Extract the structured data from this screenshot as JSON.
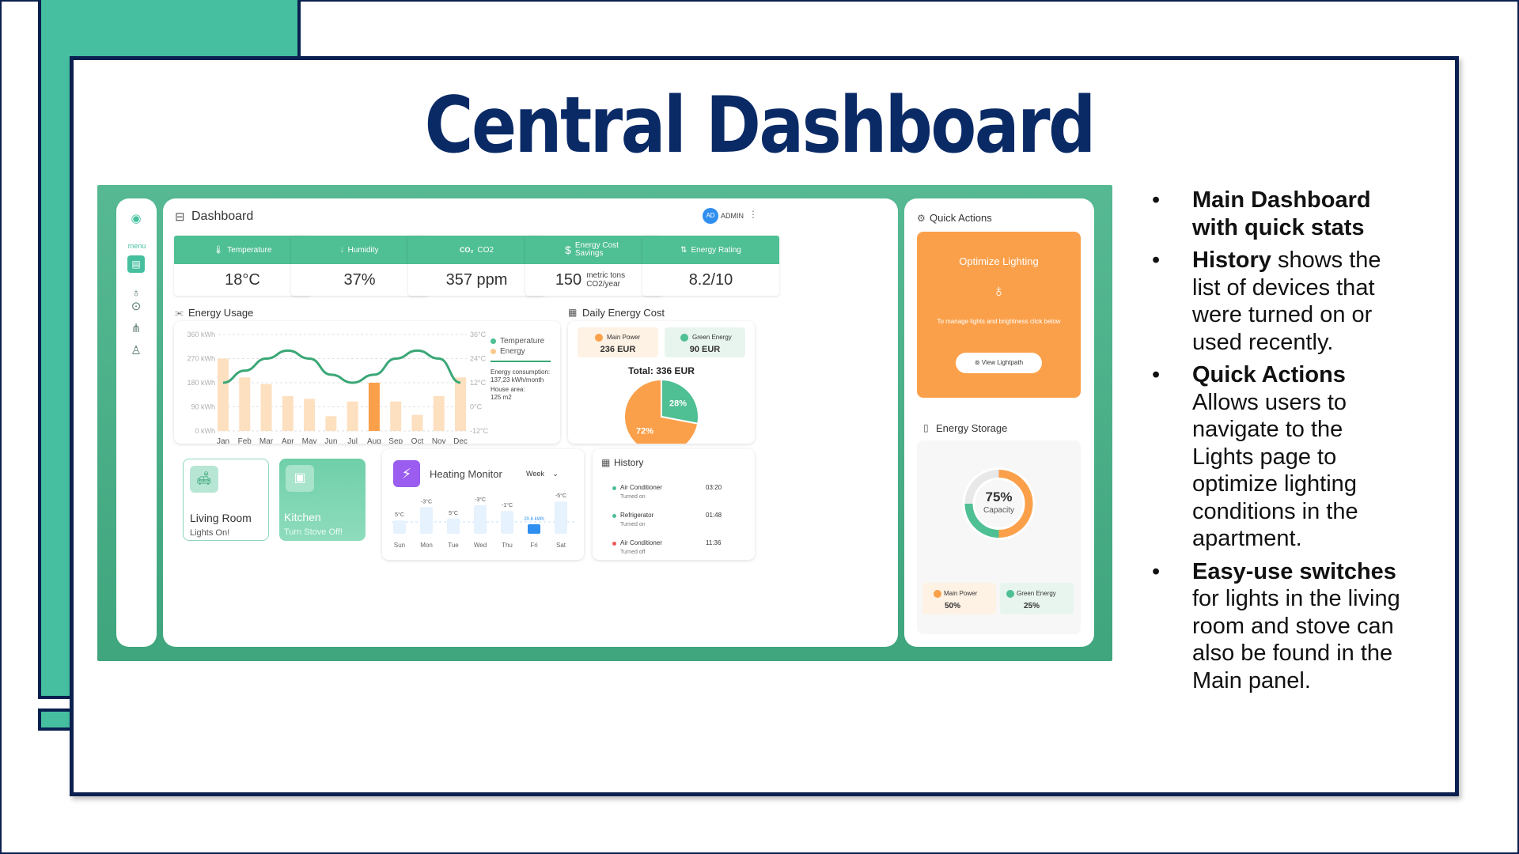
{
  "slide": {
    "title": "Central Dashboard",
    "bullets": [
      {
        "bold": "Main Dashboard with quick stats",
        "text": ""
      },
      {
        "bold": "History",
        "text": " shows the list of devices that were turned on or used recently."
      },
      {
        "bold": "Quick Actions",
        "text": " Allows users to navigate to the Lights page to optimize lighting conditions in the apartment."
      },
      {
        "bold": "Easy-use switches",
        "text": " for lights in the living room and stove can also be found in the Main panel."
      }
    ]
  },
  "colors": {
    "teal": "#45bf9f",
    "navy": "#0a2050",
    "orange": "#fba04a",
    "green": "#4fbf94",
    "purple": "#9b5cf0",
    "blue": "#2f8ff0"
  },
  "sidebar": {
    "menu_label": "menu",
    "icons": [
      "logo-icon",
      "dashboard-icon",
      "lightbulb-icon",
      "power-icon",
      "tower-icon",
      "user-icon"
    ]
  },
  "header": {
    "title": "Dashboard",
    "avatar_initials": "AD",
    "user_label": "ADMIN"
  },
  "stats": [
    {
      "label": "Temperature",
      "value": "18°C",
      "icon": "thermometer-icon"
    },
    {
      "label": "Humidity",
      "value": "37%",
      "icon": "drop-icon"
    },
    {
      "label": "CO2",
      "value": "357 ppm",
      "icon": "co2-icon"
    },
    {
      "label": "Energy Cost Savings",
      "value": "150",
      "unit": "metric tons CO2/year",
      "icon": "dollar-icon"
    },
    {
      "label": "Energy Rating",
      "value": "8.2/10",
      "icon": "rating-icon"
    }
  ],
  "energy_usage": {
    "title": "Energy Usage",
    "left_ticks": [
      "360 kWh",
      "270 kWh",
      "180 kWh",
      "90 kWh",
      "0 kWh"
    ],
    "right_ticks": [
      "36°C",
      "24°C",
      "12°C",
      "0°C",
      "-12°C"
    ],
    "legend": [
      "Temperature",
      "Energy"
    ],
    "info_consumption_label": "Energy consumption:",
    "info_consumption_value": "137,23 kWh/month",
    "info_area_label": "House area:",
    "info_area_value": "125 m2"
  },
  "chart_data": {
    "type": "bar",
    "categories": [
      "Jan",
      "Feb",
      "Mar",
      "Apr",
      "May",
      "Jun",
      "Jul",
      "Aug",
      "Sep",
      "Oct",
      "Nov",
      "Dec"
    ],
    "series": [
      {
        "name": "Energy",
        "values": [
          270,
          200,
          175,
          130,
          120,
          55,
          110,
          180,
          110,
          60,
          130,
          200
        ]
      },
      {
        "name": "Temperature",
        "values": [
          12,
          18,
          24,
          28,
          24,
          16,
          12,
          16,
          24,
          28,
          24,
          12
        ]
      }
    ],
    "highlight_index": 7,
    "ylim": [
      0,
      360
    ],
    "y2lim": [
      -12,
      36
    ]
  },
  "daily_cost": {
    "title": "Daily Energy Cost",
    "main_label": "Main Power",
    "main_value": "236 EUR",
    "green_label": "Green Energy",
    "green_value": "90 EUR",
    "total": "Total: 336 EUR",
    "pie": [
      {
        "name": "Green Energy",
        "value": 28,
        "label": "28%"
      },
      {
        "name": "Main Power",
        "value": 72,
        "label": "72%"
      }
    ]
  },
  "rooms": [
    {
      "name": "Living Room",
      "status": "Lights On!"
    },
    {
      "name": "Kitchen",
      "status": "Turn Stove Off!"
    }
  ],
  "heating": {
    "title": "Heating Monitor",
    "period": "Week",
    "days": [
      "Sun",
      "Mon",
      "Tue",
      "Wed",
      "Thu",
      "Fri",
      "Sat"
    ],
    "temps": [
      "5°C",
      "-3°C",
      "5°C",
      "-3°C",
      "-1°C",
      "20.6 kWh",
      "-5°C"
    ],
    "levels": [
      0.35,
      0.7,
      0.4,
      0.75,
      0.6,
      0.25,
      0.85
    ],
    "highlight_index": 5
  },
  "history": {
    "title": "History",
    "items": [
      {
        "device": "Air Conditioner",
        "state": "Turned on",
        "time": "03:20",
        "color": "#4fbf94"
      },
      {
        "device": "Refrigerator",
        "state": "Turned on",
        "time": "01:48",
        "color": "#4fbf94"
      },
      {
        "device": "Air Conditioner",
        "state": "Turned off",
        "time": "11:36",
        "color": "#f05a5a"
      }
    ]
  },
  "quick_actions": {
    "title": "Quick Actions",
    "card_title": "Optimize Lighting",
    "card_desc": "To manage lights and brightness click below",
    "button": "View Lightpath"
  },
  "energy_storage": {
    "title": "Energy Storage",
    "percent": "75%",
    "caption": "Capacity",
    "fill": 0.75,
    "main_label": "Main Power",
    "main_value": "50%",
    "green_label": "Green Energy",
    "green_value": "25%"
  }
}
